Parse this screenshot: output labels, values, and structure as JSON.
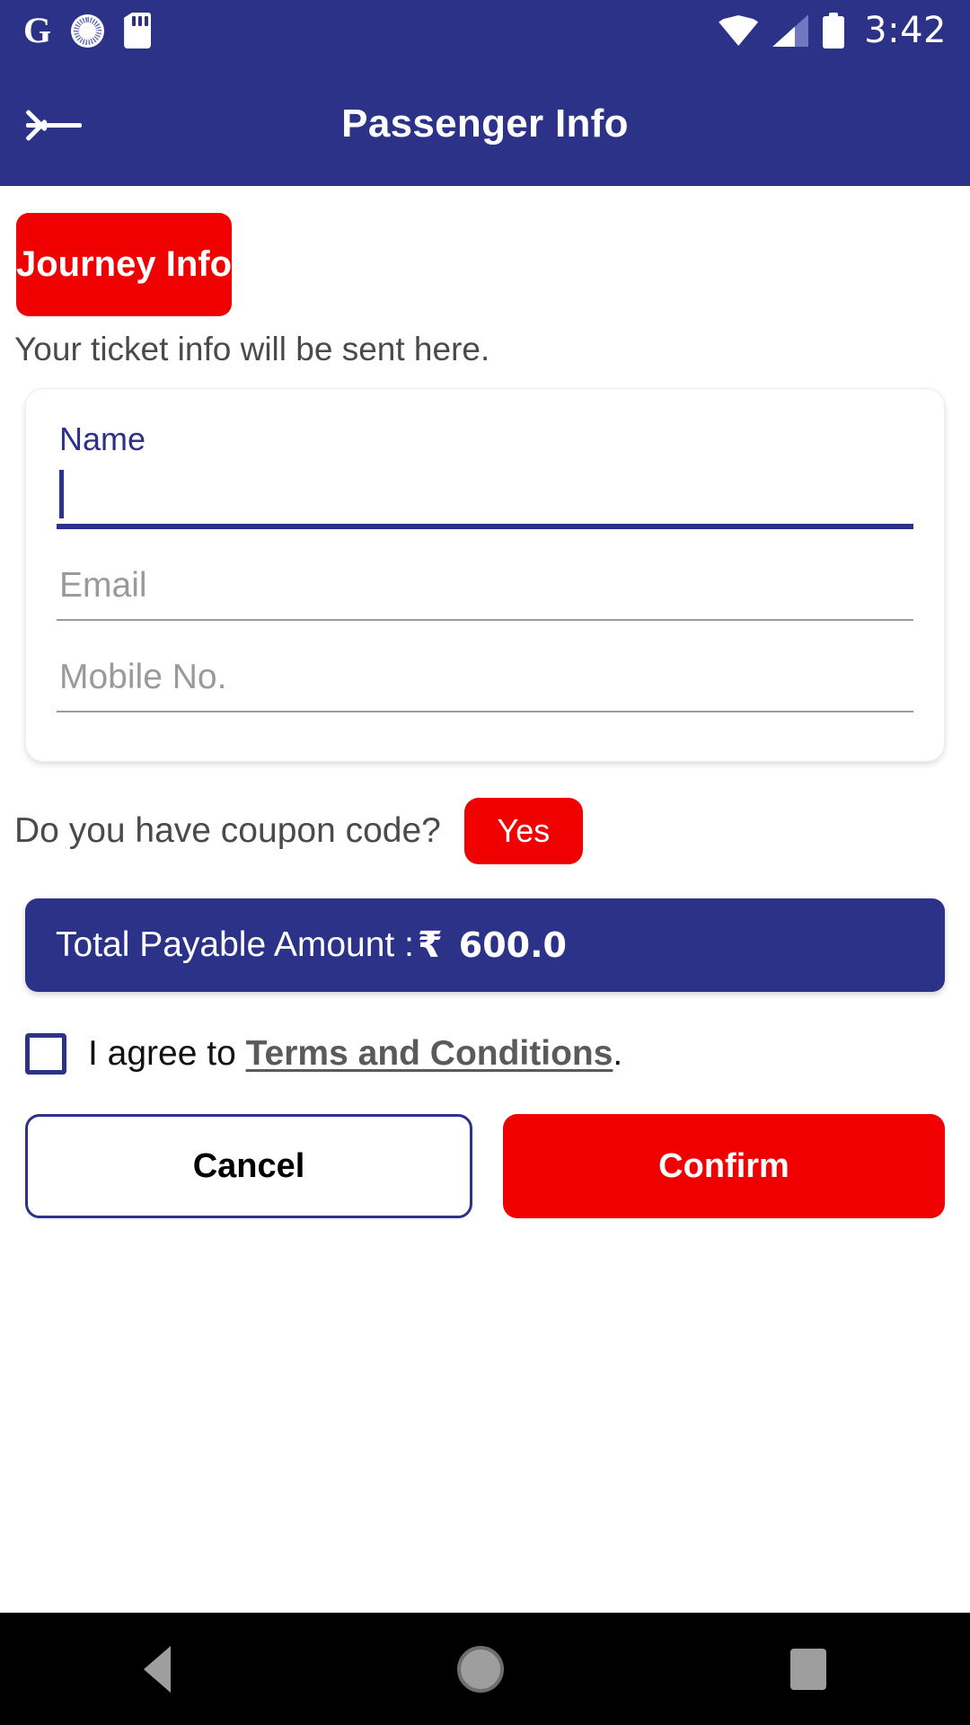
{
  "status_bar": {
    "icons": [
      "google-g-icon",
      "sync-icon",
      "sd-card-icon"
    ],
    "wifi_icon": "wifi-icon",
    "signal_icon": "cell-signal-icon",
    "battery_icon": "battery-full-icon",
    "time": "3:42"
  },
  "app_bar": {
    "back_icon": "back-arrow-icon",
    "title": "Passenger Info"
  },
  "main": {
    "journey_button": "Journey Info",
    "hint": "Your ticket info will be sent here.",
    "form": {
      "name": {
        "label": "Name",
        "value": "",
        "focused": true
      },
      "email": {
        "placeholder": "Email",
        "value": ""
      },
      "mobile": {
        "placeholder": "Mobile No.",
        "value": ""
      }
    },
    "coupon": {
      "question": "Do you have coupon code?",
      "yes_label": "Yes"
    },
    "total": {
      "label": "Total Payable Amount :",
      "currency": "₹",
      "amount": "600.0"
    },
    "terms": {
      "prefix": "I agree to ",
      "link": "Terms and Conditions",
      "suffix": ".",
      "checked": false
    },
    "actions": {
      "cancel": "Cancel",
      "confirm": "Confirm"
    }
  },
  "nav_bar": {
    "back": "nav-back-icon",
    "home": "nav-home-icon",
    "recents": "nav-recents-icon"
  },
  "colors": {
    "primary_blue": "#2B3288",
    "accent_red": "#F00000",
    "placeholder_gray": "#9A9A9A",
    "text_gray": "#4A4A4A"
  }
}
